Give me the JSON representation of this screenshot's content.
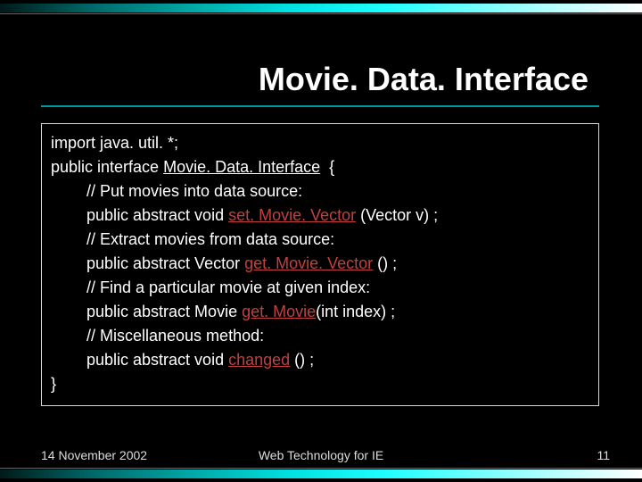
{
  "title": "Movie. Data. Interface",
  "code": {
    "l1a": "import java. util. *;",
    "l2a": "public interface ",
    "l2b": "Movie. Data. Interface",
    "l2c": "  {",
    "l3": "// Put movies into data source:",
    "l4a": "public abstract void ",
    "l4b": "set. Movie. Vector",
    "l4c": " (Vector v) ;",
    "l5": "// Extract movies from data source:",
    "l6a": "public abstract Vector ",
    "l6b": "get. Movie. Vector",
    "l6c": " () ;",
    "l7": "// Find a particular movie at given index:",
    "l8a": "public abstract Movie ",
    "l8b": "get. Movie",
    "l8c": "(int index) ;",
    "l9": "// Miscellaneous method:",
    "l10a": "public abstract void ",
    "l10b": "changed",
    "l10c": " () ;",
    "l11": "}"
  },
  "footer": {
    "date": "14 November 2002",
    "center": "Web Technology for IE",
    "page": "11"
  }
}
